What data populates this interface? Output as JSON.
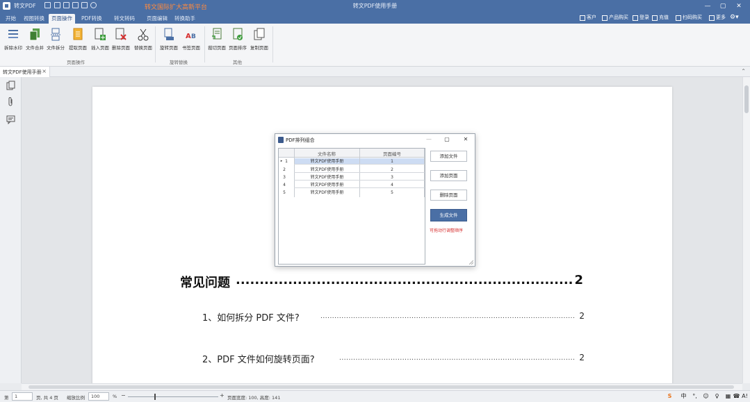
{
  "app": {
    "name": "转文PDF",
    "promo": "转文国际扩大高新平台",
    "window_title": "转文PDF使用手册",
    "window_controls": [
      "—",
      "▢",
      "✕"
    ],
    "quick_access_icons": [
      "open-icon",
      "save-icon",
      "print-icon",
      "undo-icon",
      "zoom-icon"
    ]
  },
  "menu_tabs": [
    "开始",
    "视图转换",
    "页面操作",
    "PDF转换",
    "转文转码",
    "页面编辑",
    "转换助手"
  ],
  "active_tab": "页面操作",
  "top_right": [
    "客户",
    "产品购买",
    "登录",
    "充值",
    "扫码购买",
    "更多"
  ],
  "ribbon": {
    "buttons": [
      {
        "label": "拆除水印",
        "icon": "list-icon"
      },
      {
        "label": "文件合并",
        "icon": "merge-icon"
      },
      {
        "label": "文件拆分",
        "icon": "split-icon"
      },
      {
        "label": "提取页面",
        "icon": "extract-page-icon"
      },
      {
        "label": "插入页面",
        "icon": "insert-page-icon"
      },
      {
        "label": "删除页面",
        "icon": "delete-page-icon"
      },
      {
        "label": "替换页面",
        "icon": "cut-icon"
      },
      {
        "label": "旋转页面",
        "icon": "rotate-page-icon"
      },
      {
        "label": "书签页面",
        "icon": "ab-icon"
      },
      {
        "label": "裁切页面",
        "icon": "crop-page-icon"
      },
      {
        "label": "页面排序",
        "icon": "sort-page-icon"
      },
      {
        "label": "复制页面",
        "icon": "copy-page-icon"
      }
    ],
    "groups": [
      "页面操作",
      "旋转替换",
      "其他"
    ]
  },
  "doc_tab": {
    "title": "转文PDF使用手册",
    "close": "×"
  },
  "toc": {
    "heading": "常见问题",
    "heading_page": "2",
    "items": [
      {
        "text": "1、如何拆分 PDF 文件?",
        "page": "2"
      },
      {
        "text": "2、PDF 文件如何旋转页面?",
        "page": "2"
      }
    ]
  },
  "dialog": {
    "title": "PDF排列组合",
    "columns": [
      "文件名称",
      "页面编号"
    ],
    "rows": [
      {
        "index": "1",
        "name": "转文PDF使用手册",
        "page": "1"
      },
      {
        "index": "2",
        "name": "转文PDF使用手册",
        "page": "2"
      },
      {
        "index": "3",
        "name": "转文PDF使用手册",
        "page": "3"
      },
      {
        "index": "4",
        "name": "转文PDF使用手册",
        "page": "4"
      },
      {
        "index": "5",
        "name": "转文PDF使用手册",
        "page": "5"
      }
    ],
    "selected_row": 0,
    "buttons": [
      "添加文件",
      "添加页面",
      "删除页面"
    ],
    "primary_button": "生成文件",
    "note": "可拖动行调整顺序"
  },
  "status": {
    "page_label": "第",
    "page_value": "1",
    "page_total": "页, 共 4 页",
    "zoom_label": "缩放比例",
    "zoom_value": "100",
    "zoom_unit": "%",
    "minus": "−",
    "plus": "+",
    "page_size": "页面宽度: 100, 高度: 141",
    "tray": [
      "S",
      "中",
      "°,",
      "☺",
      "♀",
      "▦",
      "☎",
      "A!"
    ]
  },
  "colors": {
    "titlebar": "#4a6fa5",
    "accent": "#4a6fa5",
    "promo": "#ff8a3d",
    "note": "#d62f2f",
    "selection": "#cddcf3"
  }
}
